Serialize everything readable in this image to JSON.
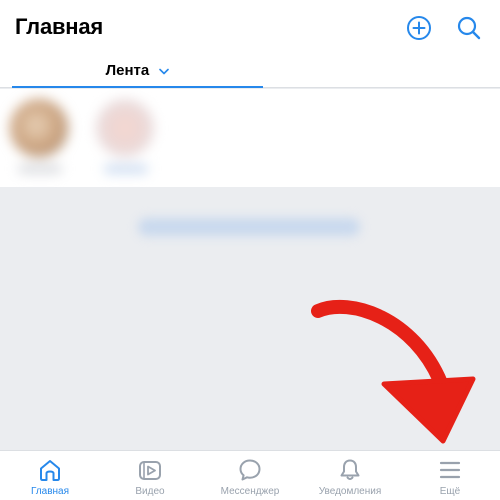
{
  "header": {
    "title": "Главная",
    "add_icon": "plus-circle-icon",
    "search_icon": "search-icon"
  },
  "feed_tabs": [
    {
      "label": "Лента",
      "active": true,
      "icon": "chevron-down-icon"
    }
  ],
  "stories": [
    {
      "name": ""
    },
    {
      "name": ""
    }
  ],
  "annotation": {
    "arrow_color": "#e62117",
    "points_to": "tabbar-item-more"
  },
  "tabbar": {
    "items": [
      {
        "label": "Главная",
        "icon": "home-icon",
        "active": true
      },
      {
        "label": "Видео",
        "icon": "video-icon",
        "active": false
      },
      {
        "label": "Мессенджер",
        "icon": "chat-bubble-icon",
        "active": false
      },
      {
        "label": "Уведомления",
        "icon": "bell-icon",
        "active": false
      },
      {
        "label": "Ещё",
        "icon": "menu-icon",
        "active": false
      }
    ]
  },
  "colors": {
    "accent": "#2688eb",
    "inactive": "#99a2ad",
    "background": "#ebedf0"
  }
}
